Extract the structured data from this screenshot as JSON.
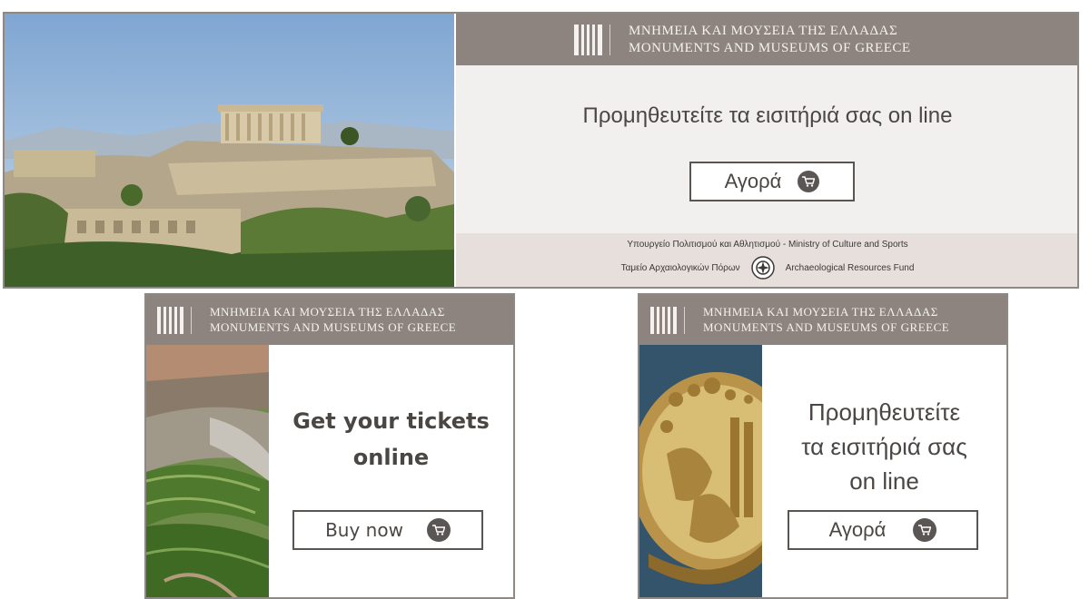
{
  "header": {
    "greek": "ΜΝΗΜΕΙΑ ΚΑΙ ΜΟΥΣΕΙΑ ΤΗΣ ΕΛΛΑΔΑΣ",
    "english": "MONUMENTS AND MUSEUMS OF GREECE"
  },
  "banner_top": {
    "headline": "Προμηθευτείτε τα εισιτήριά σας on line",
    "button_label": "Αγορά",
    "footer_line1": "Υπουργείο Πολιτισμού και Αθλητισμού - Ministry of Culture and Sports",
    "footer_fund_greek": "Ταμείο Αρχαιολογικών Πόρων",
    "footer_fund_english": "Archaeological Resources Fund"
  },
  "banner_left": {
    "headline_line1": "Get your tickets",
    "headline_line2": "online",
    "button_label": "Buy now"
  },
  "banner_right": {
    "headline_line1": "Προμηθευτείτε",
    "headline_line2": "τα εισιτήριά σας",
    "headline_line3": "on line",
    "button_label": "Αγορά"
  },
  "colors": {
    "header_bg": "#8d847f",
    "button_border": "#595553",
    "cart_icon": "#5a5654"
  }
}
